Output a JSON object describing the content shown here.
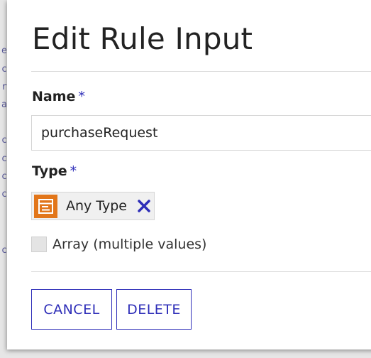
{
  "dialog": {
    "title": "Edit Rule Input",
    "name_field": {
      "label": "Name",
      "required_marker": "*",
      "value": "purchaseRequest"
    },
    "type_field": {
      "label": "Type",
      "required_marker": "*",
      "selected": {
        "label": "Any Type",
        "icon": "data-type-icon",
        "remove_icon": "close-icon"
      }
    },
    "array_checkbox": {
      "label": "Array (multiple values)",
      "checked": false
    },
    "buttons": {
      "cancel_label": "CANCEL",
      "delete_label": "DELETE"
    }
  },
  "colors": {
    "accent": "#2e2eb8",
    "type_icon": "#e2761a",
    "title_text": "#222222"
  }
}
